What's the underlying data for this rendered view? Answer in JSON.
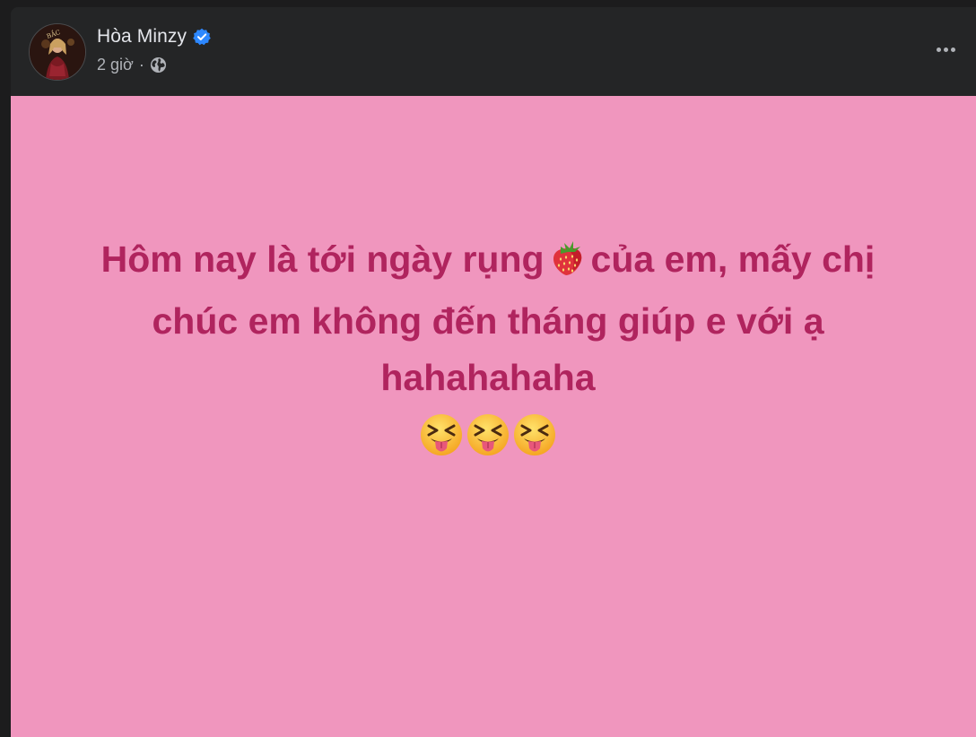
{
  "post": {
    "author": {
      "name": "Hòa Minzy",
      "verified": true,
      "avatar_icon": "avatar"
    },
    "meta": {
      "time": "2 giờ",
      "separator": "·",
      "privacy_icon": "globe-icon"
    },
    "more_icon": "more-horizontal-icon",
    "background_color": "#f096be",
    "text_color": "#b0245e",
    "text": {
      "line1_before_emoji": "Hôm nay là tới ngày rụng",
      "line1_emoji": "strawberry-icon",
      "line1_after_emoji": "của em, mấy chị",
      "line2": "chúc em không đến tháng giúp e với ạ",
      "line3": "hahahahaha",
      "emojis": [
        "squinting-face-with-tongue-icon",
        "squinting-face-with-tongue-icon",
        "squinting-face-with-tongue-icon"
      ]
    }
  },
  "colors": {
    "header_bg": "#242526",
    "name": "#e4e6eb",
    "meta": "#b0b3b8",
    "verified": "#2d88ff"
  }
}
